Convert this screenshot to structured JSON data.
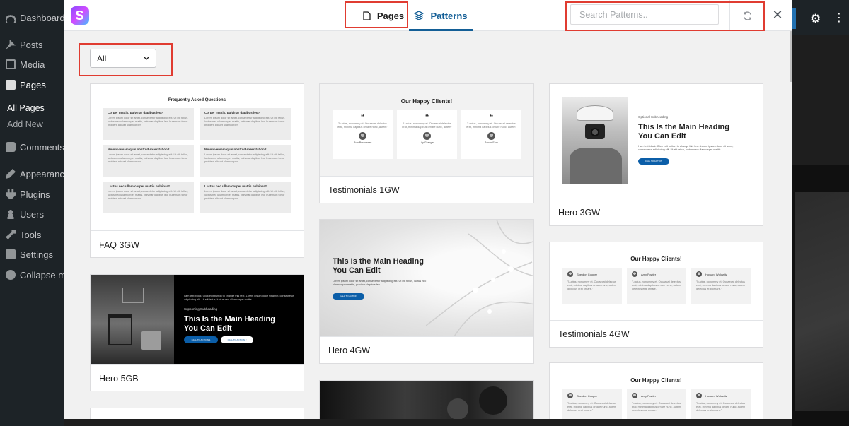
{
  "wp": {
    "menu": [
      {
        "label": "Dashboard",
        "icon": "dashboard-icon"
      },
      {
        "label": "Posts",
        "icon": "pin-icon"
      },
      {
        "label": "Media",
        "icon": "media-icon"
      },
      {
        "label": "Pages",
        "icon": "pages-icon"
      },
      {
        "label": "Comments",
        "icon": "comment-icon"
      },
      {
        "label": "Appearance",
        "icon": "brush-icon"
      },
      {
        "label": "Plugins",
        "icon": "plugin-icon"
      },
      {
        "label": "Users",
        "icon": "user-icon"
      },
      {
        "label": "Tools",
        "icon": "wrench-icon"
      },
      {
        "label": "Settings",
        "icon": "settings-icon"
      },
      {
        "label": "Collapse me",
        "icon": "collapse-icon"
      }
    ],
    "submenu": [
      "All Pages",
      "Add New"
    ]
  },
  "modal": {
    "tabs": [
      {
        "label": "Pages",
        "icon": "page-icon"
      },
      {
        "label": "Patterns",
        "icon": "layers-icon"
      }
    ],
    "search_placeholder": "Search Patterns..",
    "filter_value": "All",
    "accent": "#135e96",
    "highlight": "#e03c31"
  },
  "cards": {
    "faq3": {
      "label": "FAQ 3GW",
      "title": "Frequently Asked Questions",
      "questions": [
        "Corper mattis, pulvinar dapibus leo?",
        "Corper mattis, pulvinar dapibus leo?",
        "Minim veniam quis nostrud exercitation?",
        "Minim veniam quis nostrud exercitation?",
        "Luctus nec ullam corper mattis pulvinar?",
        "Luctus nec ullam corper mattis pulvinar?"
      ],
      "answer": "Lorem ipsum dolor sit amet, consectetur adipiscing elit. Ut elit tellus, luctus nec ullamcorper mattis, pulvinar dapibus leo. Irure nam tortor proident aliquet ullamcorper."
    },
    "testi1": {
      "label": "Testimonials 1GW",
      "title": "Our Happy Clients!",
      "quote": "\"Luctus, nonummy et. Occaecat delectus erat, minima dapibus ornare nunc, autem\"",
      "names": [
        "Ron Burrowner",
        "Lily Granger",
        "Jason Finn"
      ]
    },
    "hero3": {
      "label": "Hero 3GW",
      "subheading": "Optional Subheading",
      "heading": "This Is the Main Heading You Can Edit",
      "body": "I am text block. Click edit button to change this text. Lorem ipsum dolor sit amet, consectetur adipiscing elit. Ut elit tellus, luctus nec ullamcorper mattis.",
      "cta": "CALL TO ACTION"
    },
    "hero5": {
      "label": "Hero 5GB",
      "body": "I am text block. Click edit button to change this text. Lorem ipsum dolor sit amet, consectetur adipiscing elit. Ut elit tellus, luctus nec ullamcorper mattis.",
      "subheading": "Supporting Subheading",
      "heading": "This Is the Main Heading You Can Edit",
      "cta1": "CALL TO ACTION 1",
      "cta2": "CALL TO ACTION 2"
    },
    "hero4": {
      "label": "Hero 4GW",
      "heading": "This Is the Main Heading You Can Edit",
      "body": "Lorem ipsum dolor sit amet, consectetur adipiscing elit. Ut elit tellus, luctus nec ullamcorper mattis, pulvinar dapibus leo.",
      "cta": "CALL TO ACTION"
    },
    "testi4": {
      "label": "Testimonials 4GW",
      "title": "Our Happy Clients!",
      "names": [
        "Sheldon Cooper",
        "Amy Fowler",
        "Howard Wolowitz"
      ],
      "quote": "\"Luctus, nonummy et. Occaecat delectus erat, minima dapibus ornare nunc, autem delectus erat ornare.\""
    },
    "testi4b": {
      "title": "Our Happy Clients!",
      "names": [
        "Sheldon Cooper",
        "Amy Fowler",
        "Howard Wolowitz"
      ],
      "quote": "\"Luctus, nonummy et. Occaecat delectus erat, minima dapibus ornare nunc, autem delectus erat ornare.\""
    }
  }
}
